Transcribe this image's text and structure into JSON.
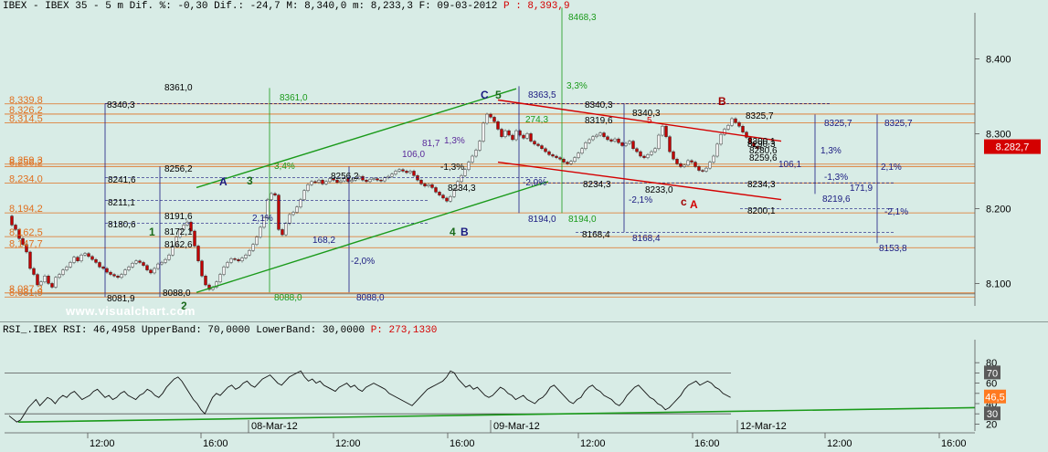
{
  "header": {
    "symbol": "IBEX - IBEX 35 - 5 m",
    "dif_pct": "Dif. %: -0,30",
    "dif": "Dif.: -24,7",
    "max": "M: 8,340,0",
    "min": "m: 8,233,3",
    "date": "F: 09-03-2012",
    "price_label": "P : 8,393,9"
  },
  "rsi_header": {
    "label": "RSI_.IBEX RSI: 46,4958 UpperBand: 70,0000 LowerBand: 30,0000",
    "price_label": "P: 273,1330"
  },
  "watermark": "www.visualchart.com",
  "colors": {
    "background": "#d8ece6",
    "candle_up": "#f0f0f0",
    "candle_down": "#c00000",
    "channel_green": "#1a9a1a",
    "channel_red": "#d40000",
    "fib_orange": "#e07020",
    "navy": "#1a1a80",
    "current_price_box": "#d40000",
    "rsi_current_box": "#ff7a20"
  },
  "chart_data": [
    {
      "type": "line",
      "title": "IBEX - IBEX 35 - 5 m",
      "ylim": [
        8070,
        8470
      ],
      "yticks": [
        8100,
        8200,
        8300,
        8400
      ],
      "ytick_labels": [
        "8.100",
        "8.200",
        "8.300",
        "8.400"
      ],
      "current_price": 8282.7,
      "current_price_label": "8.282,7",
      "x_date_labels": [
        "08-Mar-12",
        "09-Mar-12",
        "12-Mar-12"
      ],
      "x_time_labels": [
        "12:00",
        "16:00",
        "12:00",
        "16:00",
        "12:00",
        "16:00",
        "12:00",
        "16:00"
      ],
      "series": [
        {
          "values": [
            8190,
            8178,
            8172,
            8160,
            8152,
            8142,
            8120,
            8112,
            8098,
            8102,
            8110,
            8100,
            8095,
            8108,
            8112,
            8118,
            8122,
            8128,
            8135,
            8130,
            8138,
            8140,
            8136,
            8132,
            8128,
            8122,
            8120,
            8115,
            8112,
            8110,
            8108,
            8112,
            8118,
            8122,
            8127,
            8130,
            8128,
            8124,
            8118,
            8114,
            8120,
            8126,
            8128,
            8132,
            8138,
            8150,
            8162,
            8172,
            8178,
            8182,
            8170,
            8150,
            8130,
            8110,
            8098,
            8092,
            8095,
            8102,
            8112,
            8122,
            8128,
            8133,
            8132,
            8130,
            8134,
            8138,
            8144,
            8152,
            8162,
            8175,
            8188,
            8212,
            8220,
            8218,
            8172,
            8165,
            8180,
            8192,
            8195,
            8202,
            8212,
            8224,
            8232,
            8236,
            8235,
            8238,
            8233,
            8236,
            8240,
            8238,
            8235,
            8237,
            8240,
            8236,
            8238,
            8240,
            8243,
            8238,
            8236,
            8239,
            8240,
            8238,
            8237,
            8241,
            8243,
            8246,
            8250,
            8252,
            8250,
            8248,
            8250,
            8244,
            8238,
            8233,
            8230,
            8232,
            8228,
            8222,
            8218,
            8214,
            8210,
            8216,
            8226,
            8236,
            8244,
            8252,
            8262,
            8270,
            8278,
            8290,
            8314,
            8326,
            8322,
            8316,
            8306,
            8296,
            8304,
            8298,
            8292,
            8304,
            8298,
            8294,
            8300,
            8290,
            8286,
            8284,
            8280,
            8276,
            8272,
            8270,
            8268,
            8266,
            8262,
            8260,
            8263,
            8268,
            8274,
            8280,
            8288,
            8292,
            8296,
            8298,
            8301,
            8296,
            8292,
            8290,
            8293,
            8288,
            8284,
            8287,
            8290,
            8280,
            8276,
            8270,
            8268,
            8272,
            8276,
            8280,
            8298,
            8310,
            8296,
            8276,
            8266,
            8260,
            8256,
            8258,
            8264,
            8262,
            8256,
            8251,
            8250,
            8254,
            8262,
            8270,
            8286,
            8299,
            8306,
            8311,
            8320,
            8315,
            8310,
            8302,
            8295,
            8288,
            8283,
            8280,
            8282
          ]
        }
      ],
      "price_levels_left": [
        "8,339,8",
        "8,326,2",
        "8,314,5",
        "8,259,3",
        "8,256,2",
        "8,234,0",
        "8,194,2",
        "8,162,5",
        "8,147,7",
        "8,087,3",
        "8,081,9"
      ],
      "wave_labels": [
        "1",
        "2",
        "3",
        "4",
        "5",
        "A",
        "B",
        "C",
        "A",
        "B",
        "c",
        "A",
        "B"
      ],
      "annotations": [
        "8468,3",
        "3,3%",
        "8363,5",
        "8361,0",
        "8361,0",
        "8340,3",
        "8340,3",
        "8340,3",
        "8319,6",
        "274,3",
        "8325,7",
        "8325,7",
        "8325,7",
        "3,4%",
        "8256,2",
        "8256,2",
        "8241,6",
        "8234,3",
        "8234,3",
        "8234,3",
        "8211,1",
        "8194,0",
        "8194,0",
        "8191,6",
        "8180,6",
        "8172,1",
        "8168,4",
        "8168,4",
        "8162,6",
        "8153,8",
        "8200,1",
        "8219,6",
        "8233,0",
        "8259,6",
        "8280,6",
        "8300,1",
        "8290,3",
        "168,2",
        "106,0",
        "106,1",
        "171,9",
        "81,7",
        "1,3%",
        "1,3%",
        "-1,3%",
        "-1,3%",
        "2,1%",
        "2,1%",
        "-2,1%",
        "-2,1%",
        "-2,0%",
        "-2,0%",
        "8088,0",
        "8088,0",
        "8088,0",
        "8081,9",
        "5"
      ]
    },
    {
      "type": "line",
      "title": "RSI_.IBEX RSI",
      "ylim": [
        15,
        82
      ],
      "yticks": [
        20,
        30,
        40,
        50,
        60,
        70,
        80
      ],
      "upper_band": 70,
      "lower_band": 30,
      "current_value": 46.5,
      "current_value_label": "46,5",
      "series": [
        {
          "values": [
            28,
            25,
            22,
            24,
            30,
            36,
            40,
            44,
            38,
            42,
            46,
            44,
            40,
            45,
            48,
            46,
            50,
            52,
            48,
            44,
            46,
            48,
            52,
            54,
            50,
            46,
            48,
            44,
            46,
            50,
            52,
            48,
            46,
            44,
            48,
            50,
            54,
            52,
            48,
            46,
            50,
            56,
            60,
            64,
            66,
            62,
            56,
            50,
            44,
            40,
            34,
            30,
            38,
            46,
            50,
            48,
            52,
            56,
            58,
            54,
            56,
            60,
            62,
            58,
            56,
            60,
            64,
            66,
            68,
            64,
            60,
            58,
            62,
            66,
            68,
            70,
            72,
            66,
            62,
            64,
            60,
            62,
            58,
            56,
            54,
            52,
            56,
            58,
            60,
            56,
            58,
            54,
            52,
            56,
            58,
            60,
            58,
            56,
            54,
            50,
            48,
            46,
            44,
            42,
            40,
            38,
            42,
            46,
            50,
            54,
            56,
            58,
            60,
            62,
            66,
            72,
            70,
            64,
            60,
            56,
            58,
            54,
            56,
            52,
            48,
            46,
            48,
            52,
            56,
            54,
            50,
            48,
            44,
            46,
            48,
            44,
            42,
            40,
            44,
            46,
            50,
            56,
            58,
            54,
            50,
            46,
            42,
            40,
            44,
            46,
            52,
            56,
            58,
            54,
            52,
            48,
            46,
            44,
            40,
            38,
            42,
            48,
            52,
            56,
            58,
            54,
            50,
            46,
            44,
            40,
            38,
            34,
            36,
            40,
            44,
            48,
            54,
            58,
            60,
            62,
            58,
            60,
            62,
            60,
            56,
            54,
            50,
            48,
            46
          ]
        }
      ]
    }
  ]
}
